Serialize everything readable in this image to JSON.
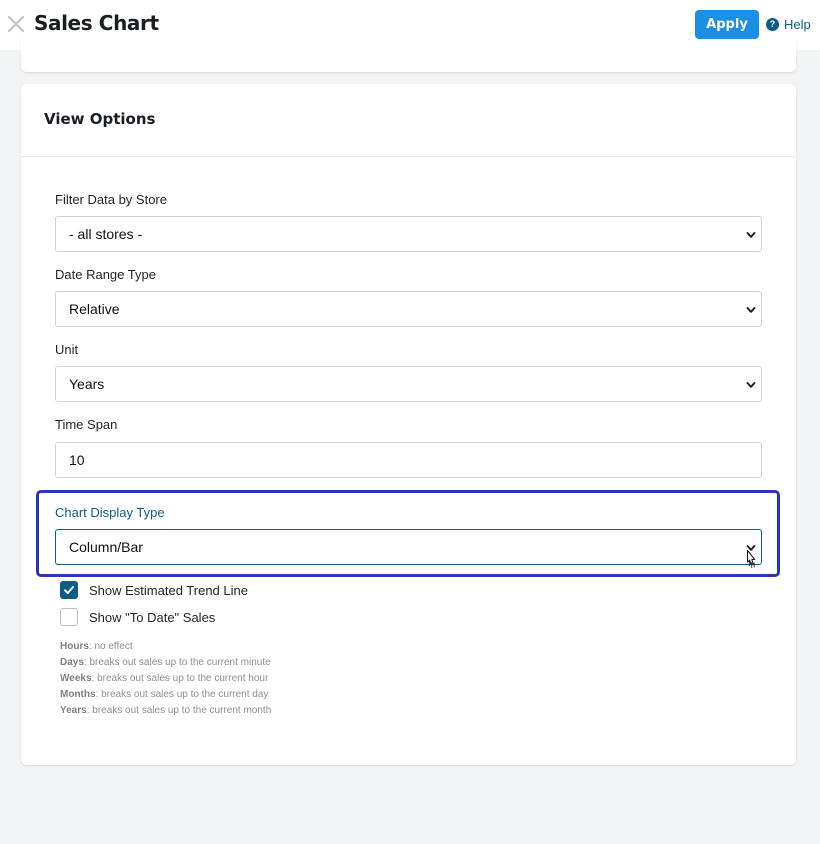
{
  "header": {
    "title": "Sales Chart",
    "apply_label": "Apply",
    "help_label": "Help",
    "help_glyph": "?"
  },
  "view_options": {
    "title": "View Options",
    "store_filter": {
      "label": "Filter Data by Store",
      "value": "- all stores -"
    },
    "date_range_type": {
      "label": "Date Range Type",
      "value": "Relative"
    },
    "unit": {
      "label": "Unit",
      "value": "Years"
    },
    "time_span": {
      "label": "Time Span",
      "value": "10"
    },
    "chart_display_type": {
      "label": "Chart Display Type",
      "value": "Column/Bar"
    },
    "checkboxes": [
      {
        "label": "Show Estimated Trend Line",
        "checked": true
      },
      {
        "label": "Show \"To Date\" Sales",
        "checked": false
      }
    ],
    "notes": [
      {
        "term": "Hours",
        "text": ": no effect"
      },
      {
        "term": "Days",
        "text": ": breaks out sales up to the current minute"
      },
      {
        "term": "Weeks",
        "text": ": breaks out sales up to the current hour"
      },
      {
        "term": "Months",
        "text": ": breaks out sales up to the current day"
      },
      {
        "term": "Years",
        "text": ": breaks out sales up to the current month"
      }
    ]
  },
  "colors": {
    "accent": "#1a8fe3",
    "link": "#0d5c86",
    "highlight_border": "#2a36b8",
    "page_background": "#f2f3f5"
  },
  "icons": [
    "close-icon",
    "help-icon",
    "chevron-down-icon",
    "checkmark-icon",
    "mouse-cursor-icon"
  ]
}
